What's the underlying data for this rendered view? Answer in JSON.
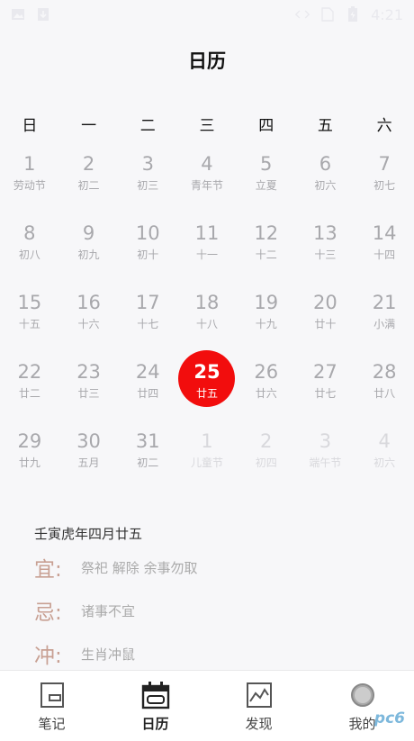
{
  "status_bar": {
    "time": "4:21"
  },
  "header": {
    "title": "日历"
  },
  "weekdays": [
    "日",
    "一",
    "二",
    "三",
    "四",
    "五",
    "六"
  ],
  "days": [
    {
      "day": "1",
      "lunar": "劳动节",
      "type": "cur"
    },
    {
      "day": "2",
      "lunar": "初二",
      "type": "cur"
    },
    {
      "day": "3",
      "lunar": "初三",
      "type": "cur"
    },
    {
      "day": "4",
      "lunar": "青年节",
      "type": "cur"
    },
    {
      "day": "5",
      "lunar": "立夏",
      "type": "cur"
    },
    {
      "day": "6",
      "lunar": "初六",
      "type": "cur"
    },
    {
      "day": "7",
      "lunar": "初七",
      "type": "cur"
    },
    {
      "day": "8",
      "lunar": "初八",
      "type": "cur"
    },
    {
      "day": "9",
      "lunar": "初九",
      "type": "cur"
    },
    {
      "day": "10",
      "lunar": "初十",
      "type": "cur"
    },
    {
      "day": "11",
      "lunar": "十一",
      "type": "cur"
    },
    {
      "day": "12",
      "lunar": "十二",
      "type": "cur"
    },
    {
      "day": "13",
      "lunar": "十三",
      "type": "cur"
    },
    {
      "day": "14",
      "lunar": "十四",
      "type": "cur"
    },
    {
      "day": "15",
      "lunar": "十五",
      "type": "cur"
    },
    {
      "day": "16",
      "lunar": "十六",
      "type": "cur"
    },
    {
      "day": "17",
      "lunar": "十七",
      "type": "cur"
    },
    {
      "day": "18",
      "lunar": "十八",
      "type": "cur"
    },
    {
      "day": "19",
      "lunar": "十九",
      "type": "cur"
    },
    {
      "day": "20",
      "lunar": "廿十",
      "type": "cur"
    },
    {
      "day": "21",
      "lunar": "小满",
      "type": "cur"
    },
    {
      "day": "22",
      "lunar": "廿二",
      "type": "cur"
    },
    {
      "day": "23",
      "lunar": "廿三",
      "type": "cur"
    },
    {
      "day": "24",
      "lunar": "廿四",
      "type": "cur"
    },
    {
      "day": "25",
      "lunar": "廿五",
      "type": "selected"
    },
    {
      "day": "26",
      "lunar": "廿六",
      "type": "cur"
    },
    {
      "day": "27",
      "lunar": "廿七",
      "type": "cur"
    },
    {
      "day": "28",
      "lunar": "廿八",
      "type": "cur"
    },
    {
      "day": "29",
      "lunar": "廿九",
      "type": "cur"
    },
    {
      "day": "30",
      "lunar": "五月",
      "type": "cur"
    },
    {
      "day": "31",
      "lunar": "初二",
      "type": "cur"
    },
    {
      "day": "1",
      "lunar": "儿童节",
      "type": "next"
    },
    {
      "day": "2",
      "lunar": "初四",
      "type": "next"
    },
    {
      "day": "3",
      "lunar": "端午节",
      "type": "next"
    },
    {
      "day": "4",
      "lunar": "初六",
      "type": "next"
    }
  ],
  "info": {
    "lunar_date": "壬寅虎年四月廿五",
    "suitable_label": "宜:",
    "suitable_text": "祭祀 解除 余事勿取",
    "avoid_label": "忌:",
    "avoid_text": "诸事不宜",
    "clash_label": "冲:",
    "clash_text": "生肖冲鼠"
  },
  "tabs": [
    {
      "label": "笔记",
      "icon": "notes-icon"
    },
    {
      "label": "日历",
      "icon": "calendar-icon"
    },
    {
      "label": "发现",
      "icon": "chart-icon"
    },
    {
      "label": "我的",
      "icon": "profile-icon"
    }
  ],
  "watermark": "pc6",
  "colors": {
    "selected": "#f20d0d",
    "label_accent": "#c8a093",
    "day_text": "#a8a8ac",
    "next_month_text": "#d8d8dc"
  }
}
